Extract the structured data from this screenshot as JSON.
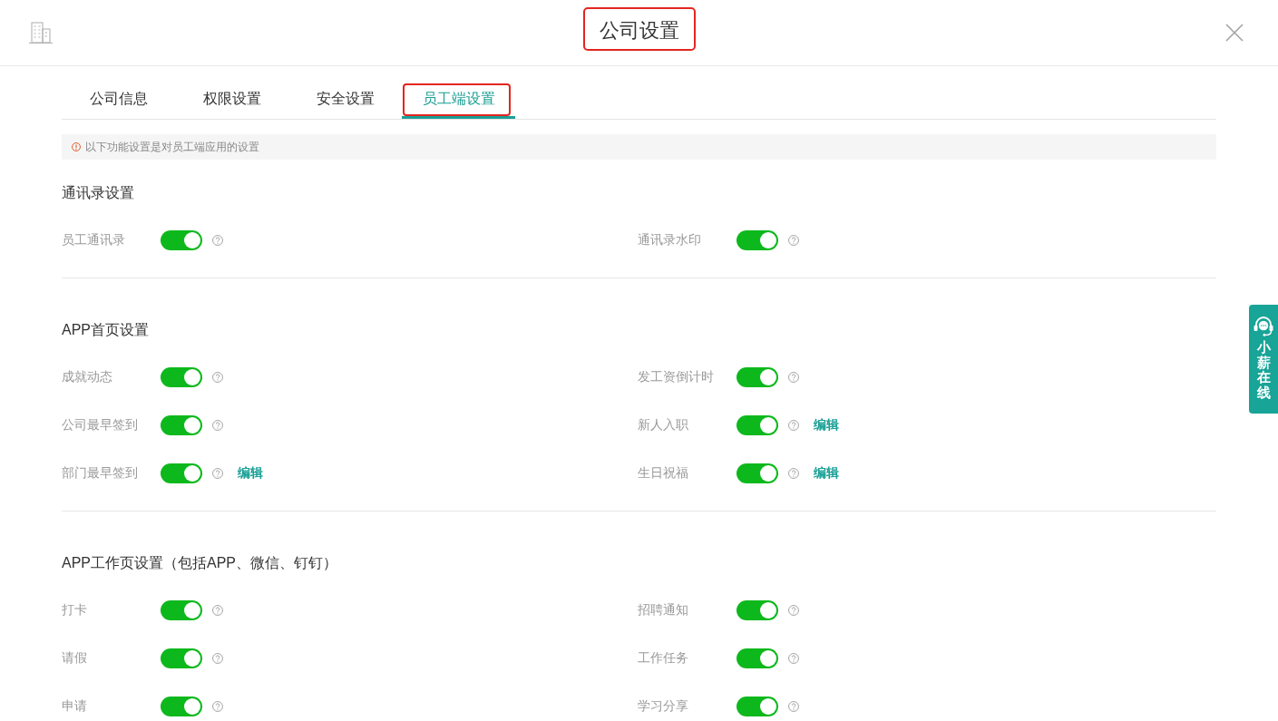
{
  "header": {
    "title": "公司设置",
    "highlighted": true
  },
  "tabs": [
    {
      "label": "公司信息",
      "selected": false,
      "highlighted": false
    },
    {
      "label": "权限设置",
      "selected": false,
      "highlighted": false
    },
    {
      "label": "安全设置",
      "selected": false,
      "highlighted": false
    },
    {
      "label": "员工端设置",
      "selected": true,
      "highlighted": true
    }
  ],
  "notice": {
    "text": "以下功能设置是对员工端应用的设置"
  },
  "sections": [
    {
      "title": "通讯录设置",
      "items": [
        {
          "label": "员工通讯录",
          "on": true
        },
        {
          "label": "通讯录水印",
          "on": true
        }
      ]
    },
    {
      "title": "APP首页设置",
      "items": [
        {
          "label": "成就动态",
          "on": true
        },
        {
          "label": "发工资倒计时",
          "on": true
        },
        {
          "label": "公司最早签到",
          "on": true
        },
        {
          "label": "新人入职",
          "on": true,
          "link": "编辑"
        },
        {
          "label": "部门最早签到",
          "on": true,
          "link": "编辑"
        },
        {
          "label": "生日祝福",
          "on": true,
          "link": "编辑"
        }
      ]
    },
    {
      "title": "APP工作页设置（包括APP、微信、钉钉）",
      "items": [
        {
          "label": "打卡",
          "on": true
        },
        {
          "label": "招聘通知",
          "on": true
        },
        {
          "label": "请假",
          "on": true
        },
        {
          "label": "工作任务",
          "on": true
        },
        {
          "label": "申请",
          "on": true
        },
        {
          "label": "学习分享",
          "on": true
        }
      ]
    }
  ],
  "support_widget": {
    "label": "小薪在线"
  }
}
